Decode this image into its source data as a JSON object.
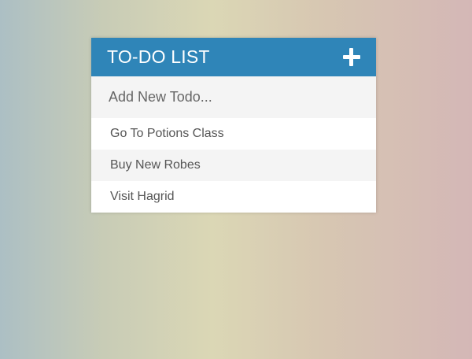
{
  "card": {
    "title": "TO-DO LIST",
    "add_icon": "plus-icon"
  },
  "input": {
    "placeholder": "Add New Todo...",
    "value": ""
  },
  "todos": [
    {
      "label": "Go To Potions Class"
    },
    {
      "label": "Buy New Robes"
    },
    {
      "label": "Visit Hagrid"
    }
  ],
  "colors": {
    "header": "#2f85b8",
    "header_text": "#ffffff",
    "input_bg": "#f4f4f4",
    "alt_row": "#f4f4f4",
    "text": "#555555"
  }
}
